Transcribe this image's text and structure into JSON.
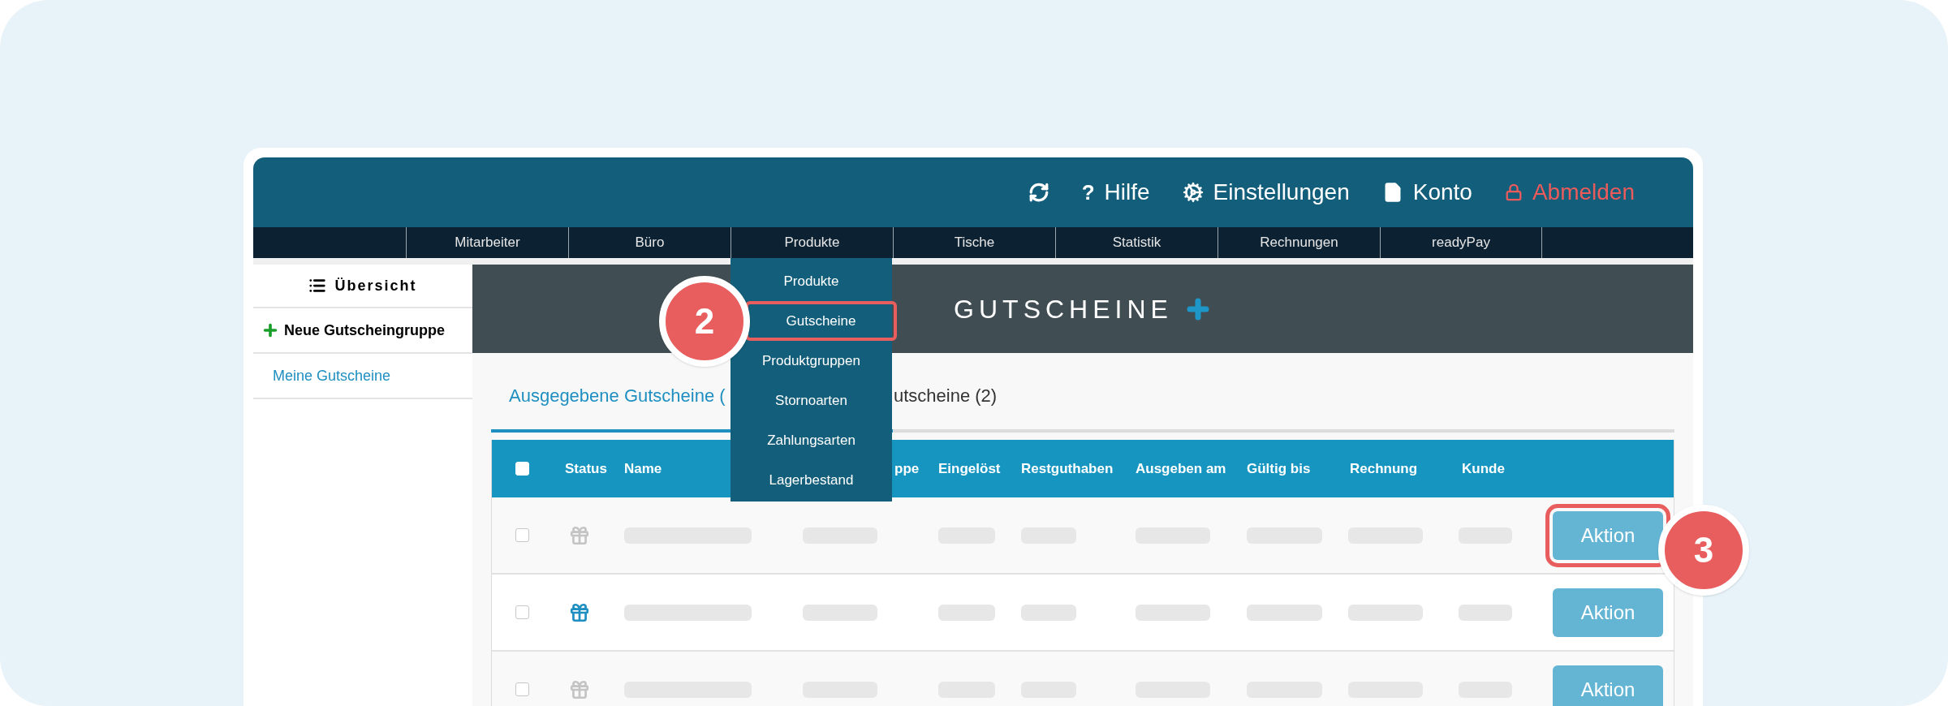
{
  "topbar": {
    "items": [
      {
        "kind": "help",
        "icon": "?",
        "label": "Hilfe"
      },
      {
        "kind": "settings",
        "label": "Einstellungen"
      },
      {
        "kind": "account",
        "label": "Konto"
      },
      {
        "kind": "logout",
        "label": "Abmelden"
      }
    ]
  },
  "nav": [
    {
      "label": "Mitarbeiter"
    },
    {
      "label": "Büro"
    },
    {
      "label": "Produkte",
      "expanded": true,
      "menu": [
        {
          "label": "Produkte",
          "highlighted": false
        },
        {
          "label": "Gutscheine",
          "highlighted": true,
          "callout": "2"
        },
        {
          "label": "Produktgruppen",
          "highlighted": false
        },
        {
          "label": "Stornoarten",
          "highlighted": false
        },
        {
          "label": "Zahlungsarten",
          "highlighted": false
        },
        {
          "label": "Lagerbestand",
          "highlighted": false
        }
      ]
    },
    {
      "label": "Tische"
    },
    {
      "label": "Statistik"
    },
    {
      "label": "Rechnungen"
    },
    {
      "label": "readyPay"
    }
  ],
  "sidebar": {
    "items": [
      {
        "kind": "heading",
        "label": "Übersicht"
      },
      {
        "kind": "action",
        "label": "Neue Gutscheingruppe"
      },
      {
        "kind": "link",
        "label": "Meine Gutscheine"
      }
    ]
  },
  "banner": {
    "title": "GUTSCHEINE"
  },
  "tabs": [
    {
      "label": "Ausgegebene Gutscheine (",
      "selected": true
    },
    {
      "label": "utscheine (2)",
      "selected": false
    }
  ],
  "table": {
    "columns": [
      "Status",
      "Name",
      "ppe",
      "Eingelöst",
      "Restguthaben",
      "Ausgeben am",
      "Gültig bis",
      "Rechnung",
      "Kunde"
    ],
    "header_checked": false,
    "rows": [
      {
        "checked": false,
        "active": false,
        "action": "Aktion",
        "callout": "3"
      },
      {
        "checked": false,
        "active": true,
        "action": "Aktion"
      },
      {
        "checked": false,
        "active": false,
        "action": "Aktion"
      }
    ]
  }
}
